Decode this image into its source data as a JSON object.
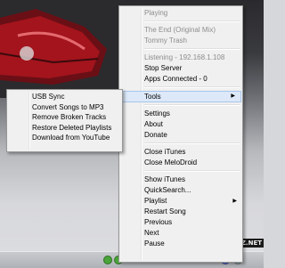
{
  "main_menu": {
    "items": [
      {
        "label": "Playing",
        "disabled": true
      },
      {
        "sep": true
      },
      {
        "label": "The End (Original Mix)",
        "disabled": true
      },
      {
        "label": "Tommy Trash",
        "disabled": true
      },
      {
        "sep": true
      },
      {
        "label": "Listening - 192.168.1.108",
        "disabled": true
      },
      {
        "label": "Stop Server"
      },
      {
        "label": "Apps Connected - 0"
      },
      {
        "sep": true
      },
      {
        "label": "Tools",
        "submenu": true,
        "highlighted": true
      },
      {
        "sep": true
      },
      {
        "label": "Settings"
      },
      {
        "label": "About"
      },
      {
        "label": "Donate"
      },
      {
        "sep": true
      },
      {
        "label": "Close iTunes"
      },
      {
        "label": "Close MeloDroid"
      },
      {
        "sep": true
      },
      {
        "label": "Show iTunes"
      },
      {
        "label": "QuickSearch..."
      },
      {
        "label": "Playlist",
        "submenu": true
      },
      {
        "label": "Restart Song"
      },
      {
        "label": "Previous"
      },
      {
        "label": "Next"
      },
      {
        "label": "Pause"
      }
    ]
  },
  "tools_submenu": {
    "items": [
      {
        "label": "USB Sync"
      },
      {
        "label": "Convert Songs to MP3"
      },
      {
        "label": "Remove Broken Tracks"
      },
      {
        "label": "Restore Deleted Playlists"
      },
      {
        "label": "Download from YouTube"
      }
    ]
  },
  "watermark": "EZ.NET",
  "arrow_glyph": "▶",
  "icons": [
    "arrow-right-icon",
    "tray-icon"
  ]
}
